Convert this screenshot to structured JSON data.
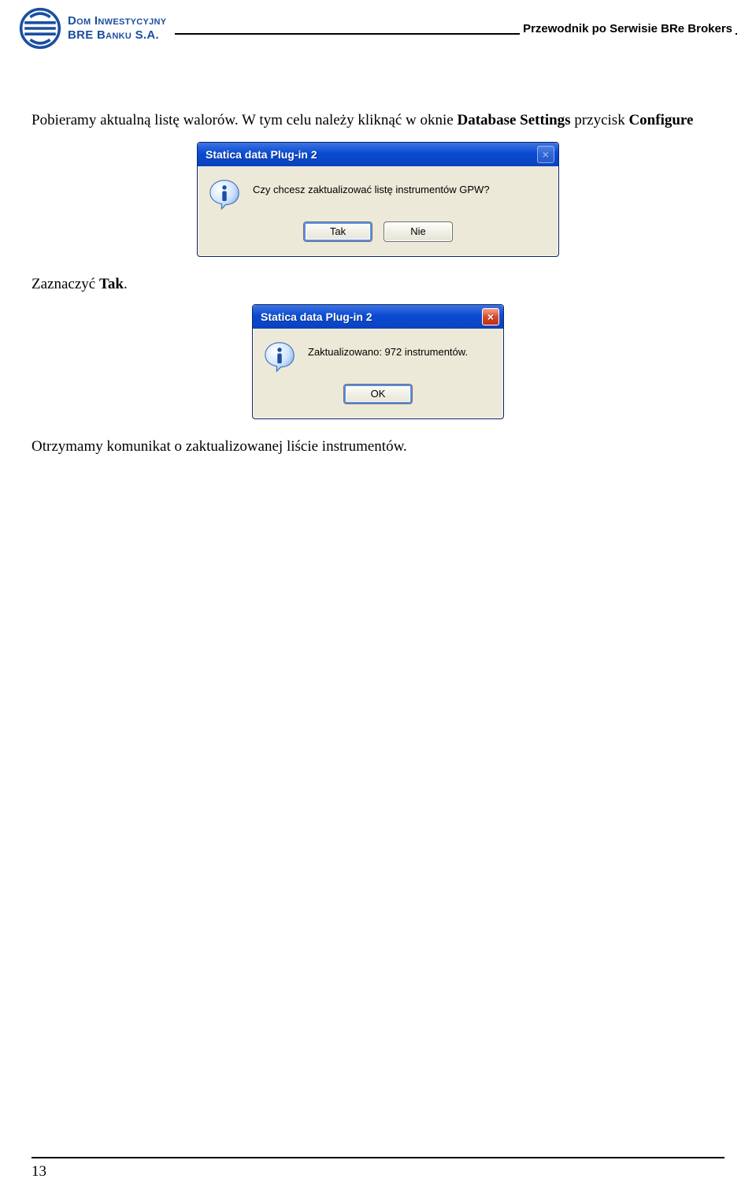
{
  "header": {
    "logo_line1": "Dom Inwestycyjny",
    "logo_line2": "BRE Banku S.A.",
    "title": "Przewodnik po Serwisie BRe Brokers"
  },
  "body": {
    "para1_a": "Pobieramy aktualną listę walorów. W tym celu należy kliknąć w oknie ",
    "para1_b": "Database Settings",
    "para1_c": " przycisk ",
    "para1_d": "Configure",
    "caption1_a": "Zaznaczyć ",
    "caption1_b": "Tak",
    "caption1_c": ".",
    "caption2": "Otrzymamy komunikat o zaktualizowanej liście instrumentów."
  },
  "dialog1": {
    "title": "Statica data Plug-in 2",
    "message": "Czy chcesz zaktualizować listę instrumentów GPW?",
    "btn_yes": "Tak",
    "btn_no": "Nie"
  },
  "dialog2": {
    "title": "Statica data Plug-in 2",
    "message": "Zaktualizowano: 972 instrumentów.",
    "btn_ok": "OK"
  },
  "footer": {
    "page": "13"
  }
}
